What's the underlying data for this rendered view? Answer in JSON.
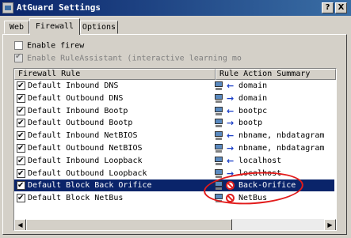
{
  "window": {
    "title": "AtGuard Settings",
    "help_btn": "?",
    "close_btn": "X"
  },
  "tabs": [
    {
      "label": "Web",
      "active": false
    },
    {
      "label": "Firewall",
      "active": true
    },
    {
      "label": "Options",
      "active": false
    }
  ],
  "options": {
    "enable_firewall": {
      "label": "Enable firew",
      "checked": false
    },
    "enable_ruleassistant": {
      "label": "Enable RuleAssistant (interactive learning mo",
      "checked": true,
      "disabled": true
    }
  },
  "list": {
    "columns": [
      "Firewall Rule",
      "Rule Action Summary"
    ],
    "rows": [
      {
        "name": "Default Inbound DNS",
        "icon": "arrow-left",
        "summary": "domain",
        "checked": true,
        "selected": false
      },
      {
        "name": "Default Outbound DNS",
        "icon": "arrow-right",
        "summary": "domain",
        "checked": true,
        "selected": false
      },
      {
        "name": "Default Inbound Bootp",
        "icon": "arrow-left",
        "summary": "bootpc",
        "checked": true,
        "selected": false
      },
      {
        "name": "Default Outbound Bootp",
        "icon": "arrow-right",
        "summary": "bootp",
        "checked": true,
        "selected": false
      },
      {
        "name": "Default Inbound NetBIOS",
        "icon": "arrow-left",
        "summary": "nbname, nbdatagram",
        "checked": true,
        "selected": false
      },
      {
        "name": "Default Outbound NetBIOS",
        "icon": "arrow-right",
        "summary": "nbname, nbdatagram",
        "checked": true,
        "selected": false
      },
      {
        "name": "Default Inbound Loopback",
        "icon": "arrow-left",
        "summary": "localhost",
        "checked": true,
        "selected": false
      },
      {
        "name": "Default Outbound Loopback",
        "icon": "arrow-right",
        "summary": "localhost",
        "checked": true,
        "selected": false
      },
      {
        "name": "Default Block Back Orifice",
        "icon": "block",
        "summary": "Back-Orifice",
        "checked": true,
        "selected": true
      },
      {
        "name": "Default Block NetBus",
        "icon": "block",
        "summary": "NetBus",
        "checked": true,
        "selected": false
      }
    ]
  },
  "colors": {
    "selection": "#0a246a",
    "annotation": "#e21b1b",
    "face": "#d4d0c8"
  }
}
